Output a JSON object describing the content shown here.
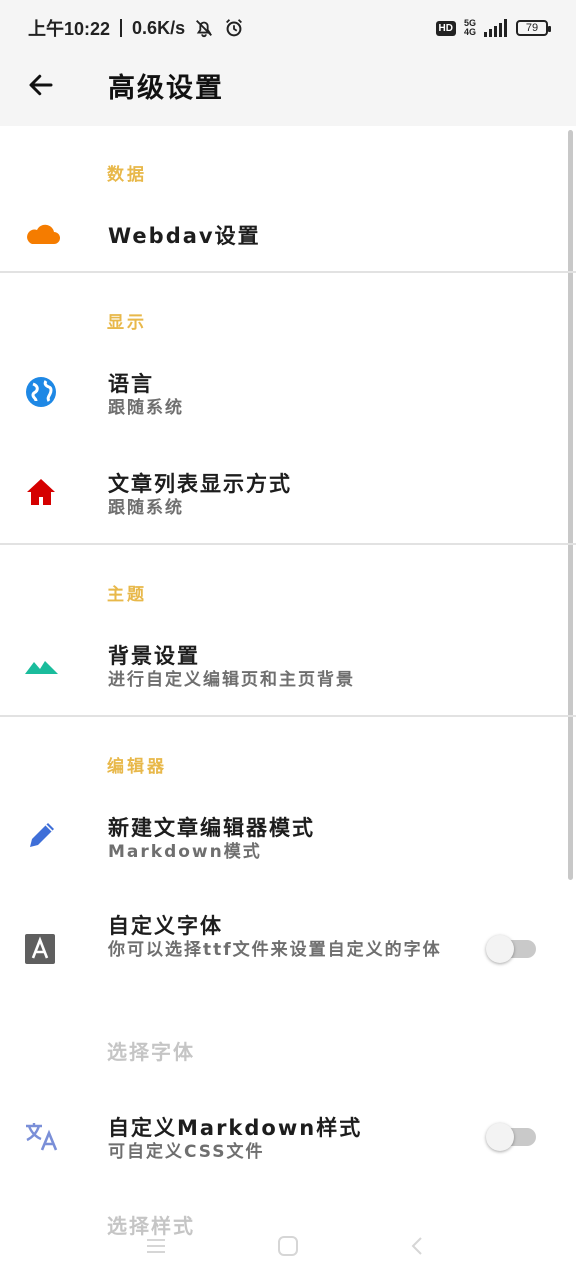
{
  "status": {
    "time": "上午10:22",
    "speed": "0.6K/s",
    "hd": "HD",
    "network": "5G",
    "network_sub": "4G",
    "battery": "79"
  },
  "appbar": {
    "title": "高级设置",
    "back_icon": "arrow-left-icon"
  },
  "sections": {
    "data": "数据",
    "display": "显示",
    "theme": "主题",
    "editor": "编辑器"
  },
  "items": {
    "webdav": {
      "title": "Webdav设置",
      "icon": "cloud-icon",
      "color": "#f57c00"
    },
    "language": {
      "title": "语言",
      "subtitle": "跟随系统",
      "icon": "globe-icon",
      "color": "#1e88e5"
    },
    "list_mode": {
      "title": "文章列表显示方式",
      "subtitle": "跟随系统",
      "icon": "home-icon",
      "color": "#d50000"
    },
    "background": {
      "title": "背景设置",
      "subtitle": "进行自定义编辑页和主页背景",
      "icon": "landscape-icon",
      "color": "#1abc9c"
    },
    "editor_mode": {
      "title": "新建文章编辑器模式",
      "subtitle": "Markdown模式",
      "icon": "pencil-icon",
      "color": "#3f6fd8"
    },
    "custom_font": {
      "title": "自定义字体",
      "subtitle": "你可以选择ttf文件来设置自定义的字体",
      "icon": "font-icon",
      "color": "#5f5f5f",
      "enabled": false
    },
    "select_font": {
      "title": "选择字体"
    },
    "custom_markdown": {
      "title": "自定义Markdown样式",
      "subtitle": "可自定义CSS文件",
      "icon": "translate-icon",
      "color": "#7a8fd8",
      "enabled": false
    },
    "select_style": {
      "title": "选择样式"
    }
  },
  "accent_color": "#e8b84a",
  "navbar": {
    "icons": [
      "menu-icon",
      "home-square-icon",
      "back-chevron-icon"
    ]
  }
}
